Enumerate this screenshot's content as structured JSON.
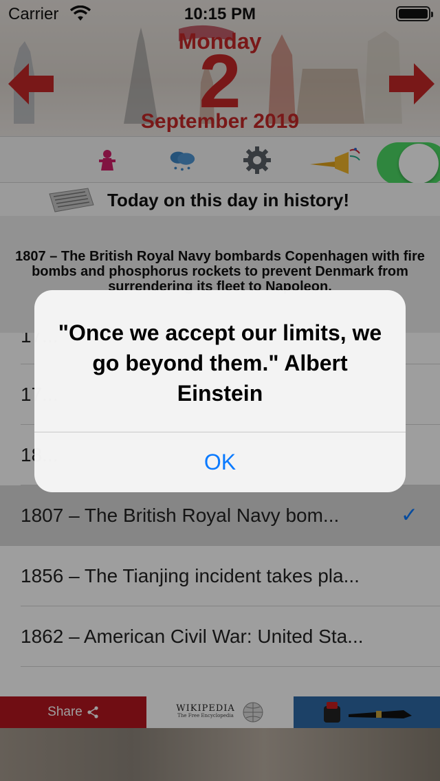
{
  "status_bar": {
    "carrier": "Carrier",
    "time": "10:15 PM"
  },
  "header": {
    "day_name": "Monday",
    "day_number": "2",
    "month_year": "September 2019"
  },
  "toolbar": {
    "icons": [
      "character-icon",
      "weather-icon",
      "gear-icon",
      "trumpet-icon"
    ],
    "toggle_on": true
  },
  "history": {
    "title": "Today on this day in history!",
    "featured": "1807 – The British Royal Navy bombards Copenhagen with fire bombs and phosphorus rockets to prevent Denmark from surrendering its fleet to Napoleon."
  },
  "list": {
    "rows": [
      {
        "text": "17...",
        "selected": false
      },
      {
        "text": "17...",
        "selected": false
      },
      {
        "text": "18...",
        "selected": false
      },
      {
        "text": "1807 – The British Royal Navy bom...",
        "selected": true
      },
      {
        "text": "1856 – The Tianjing incident takes pla...",
        "selected": false
      },
      {
        "text": "1862 – American Civil War: United Sta...",
        "selected": false
      }
    ]
  },
  "bottom_bar": {
    "share_label": "Share",
    "wiki_title": "WIKIPEDIA",
    "wiki_subtitle": "The Free Encyclopedia"
  },
  "alert": {
    "message": "\"Once we accept our limits, we go beyond them.\" Albert Einstein",
    "ok_label": "OK"
  },
  "colors": {
    "accent_red": "#c42727",
    "ios_blue": "#0a7aff",
    "toggle_green": "#4cd964",
    "share_red": "#b5161f"
  }
}
